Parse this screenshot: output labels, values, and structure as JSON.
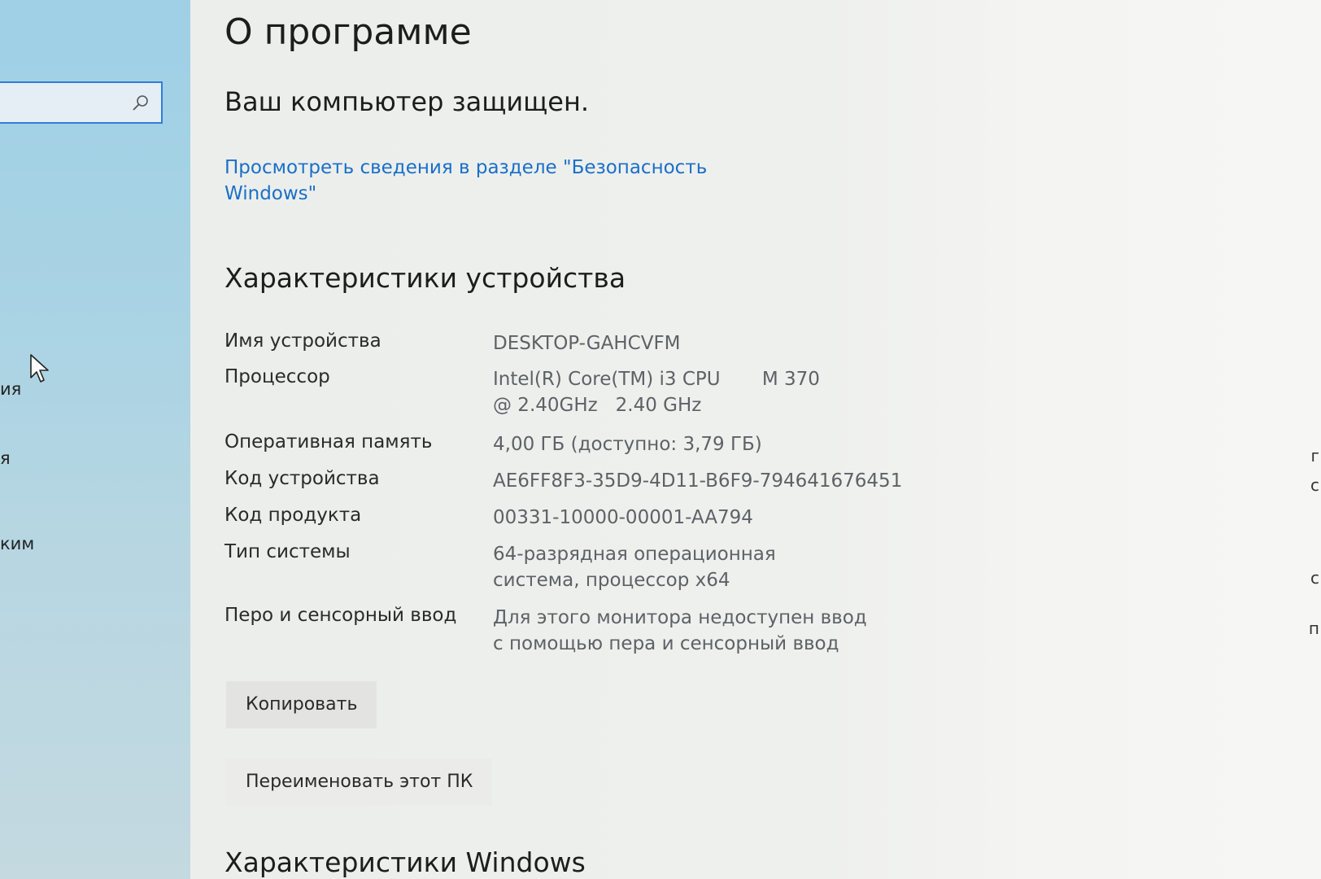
{
  "nav": {
    "search": {
      "value": "",
      "placeholder": ""
    },
    "partial_items": [
      "ия",
      "я",
      "ким"
    ]
  },
  "page": {
    "title": "О программе",
    "protection_status": "Ваш компьютер защищен.",
    "security_link": "Просмотреть сведения в разделе \"Безопасность Windows\""
  },
  "device_specs": {
    "heading": "Характеристики устройства",
    "rows": [
      {
        "label": "Имя устройства",
        "value": "DESKTOP-GAHCVFM"
      },
      {
        "label": "Процессор",
        "value": "Intel(R) Core(TM) i3 CPU       M 370  @ 2.40GHz   2.40 GHz"
      },
      {
        "label": "Оперативная память",
        "value": "4,00 ГБ (доступно: 3,79 ГБ)"
      },
      {
        "label": "Код устройства",
        "value": "AE6FF8F3-35D9-4D11-B6F9-794641676451"
      },
      {
        "label": "Код продукта",
        "value": "00331-10000-00001-AA794"
      },
      {
        "label": "Тип системы",
        "value": "64-разрядная операционная система, процессор x64"
      },
      {
        "label": "Перо и сенсорный ввод",
        "value": "Для этого монитора недоступен ввод с помощью пера и сенсорный ввод"
      }
    ],
    "copy_button": "Копировать",
    "rename_button": "Переименовать этот ПК"
  },
  "windows_specs": {
    "heading": "Характеристики Windows"
  },
  "right_edge": [
    "г",
    "с",
    "с",
    "п"
  ]
}
